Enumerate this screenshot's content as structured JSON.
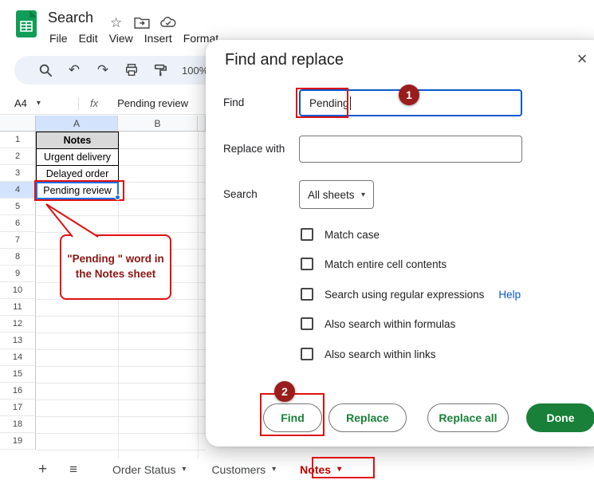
{
  "colors": {
    "accent_blue": "#0b57d0",
    "selection_blue": "#1a73e8",
    "button_green": "#188038",
    "annotation_red": "#e01010",
    "badge_red": "#9b1c1c",
    "callout_text_red": "#8e1414",
    "selected_header_blue": "#d3e3fd",
    "toolbar_bg": "#edf2fa"
  },
  "app": {
    "title": "Search",
    "menu": [
      "File",
      "Edit",
      "View",
      "Insert",
      "Format"
    ],
    "toolbar": {
      "zoom": "100%"
    },
    "name_box": "A4",
    "formula_value": "Pending review"
  },
  "grid": {
    "column_headers": [
      "A",
      "B"
    ],
    "row_count": 19,
    "selected_cell": "A4",
    "cells": [
      {
        "row": 1,
        "text": "Notes",
        "header": true
      },
      {
        "row": 2,
        "text": "Urgent delivery"
      },
      {
        "row": 3,
        "text": "Delayed order"
      },
      {
        "row": 4,
        "text": "Pending review",
        "selected": true
      }
    ]
  },
  "dialog": {
    "title": "Find and replace",
    "find": {
      "label": "Find",
      "value": "Pending"
    },
    "replace": {
      "label": "Replace with",
      "value": ""
    },
    "search": {
      "label": "Search",
      "value": "All sheets"
    },
    "checkboxes": [
      "Match case",
      "Match entire cell contents",
      "Search using regular expressions",
      "Also search within formulas",
      "Also search within links"
    ],
    "help_link": "Help",
    "buttons": {
      "find": "Find",
      "replace": "Replace",
      "replace_all": "Replace all",
      "done": "Done"
    }
  },
  "annotations": {
    "badge1": "1",
    "badge2": "2",
    "callout": {
      "line1": "\"Pending \" word in",
      "line2": "the Notes sheet"
    }
  },
  "sheetbar": {
    "tabs": [
      {
        "label": "Order Status",
        "active": false
      },
      {
        "label": "Customers",
        "active": false
      },
      {
        "label": "Notes",
        "active": true
      }
    ]
  },
  "icons": {
    "dropdown": "▾",
    "undo": "↶",
    "redo": "↷",
    "star": "☆",
    "close": "×",
    "plus": "+",
    "menu": "≡",
    "fx": "fx"
  }
}
